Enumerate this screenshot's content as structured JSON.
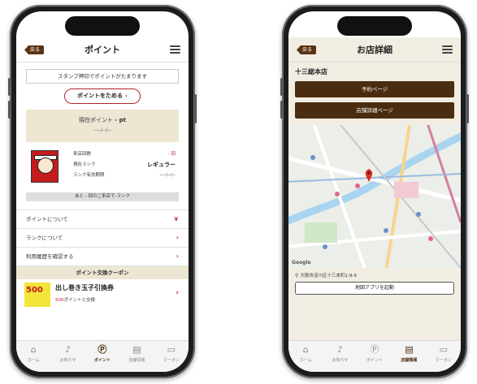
{
  "left_screen": {
    "back_label": "戻る",
    "title": "ポイント",
    "stamp_note": "スタンプ押印でポイントがたまります",
    "collect_button": "ポイントをためる",
    "current_points_label": "現在ポイント",
    "current_points_value": "- pt",
    "points_date": "----/--/--",
    "rank": {
      "visits_label": "来店回数",
      "visits_value": "- 回",
      "current_rank_label": "現在ランク",
      "current_rank_value": "レギュラー",
      "rank_expiry_label": "ランク有効期限",
      "rank_expiry_value": "----/--/--",
      "next_rank_note": "あと - 回のご来店で-ランク"
    },
    "menu_items": [
      {
        "label": "ポイントについて",
        "chevron": "∨"
      },
      {
        "label": "ランクについて",
        "chevron": "›"
      },
      {
        "label": "利用履歴を確認する",
        "chevron": "›"
      }
    ],
    "coupon_section_title": "ポイント交換クーポン",
    "coupon": {
      "image_text": "500",
      "title": "出し巻き玉子引換券",
      "points": "500",
      "points_suffix": "ポイントと交換"
    }
  },
  "right_screen": {
    "back_label": "戻る",
    "title": "お店詳細",
    "store_name": "十三総本店",
    "reserve_button": "予約ページ",
    "details_button": "店舗詳細ページ",
    "map_brand": "Google",
    "address": "大阪市淀川区十三本町1-9-9",
    "map_app_button": "地図アプリを起動"
  },
  "tabs": [
    {
      "label": "ホーム",
      "icon": "home-icon",
      "glyph": "⌂"
    },
    {
      "label": "お知らせ",
      "icon": "bell-icon",
      "glyph": "🔔"
    },
    {
      "label": "ポイント",
      "icon": "point-card-icon",
      "glyph": "Ⓟ"
    },
    {
      "label": "店舗情報",
      "icon": "store-icon",
      "glyph": "▤"
    },
    {
      "label": "クーポン",
      "icon": "coupon-icon",
      "glyph": "▭"
    }
  ],
  "colors": {
    "accent_brown": "#4a2c10",
    "accent_red": "#c0272d",
    "beige": "#ece6d3"
  }
}
